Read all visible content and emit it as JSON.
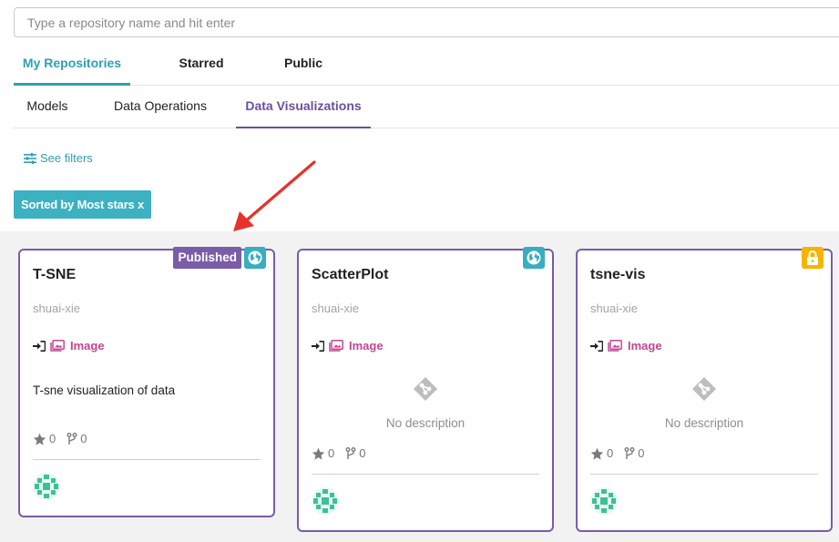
{
  "search": {
    "placeholder": "Type a repository name and hit enter"
  },
  "main_tabs": [
    {
      "label": "My Repositories",
      "active": true
    },
    {
      "label": "Starred",
      "active": false
    },
    {
      "label": "Public",
      "active": false
    }
  ],
  "sub_tabs": [
    {
      "label": "Models",
      "active": false
    },
    {
      "label": "Data Operations",
      "active": false
    },
    {
      "label": "Data Visualizations",
      "active": true
    }
  ],
  "filters": {
    "label": "See filters"
  },
  "sort": {
    "label": "Sorted by Most stars x"
  },
  "cards": [
    {
      "title": "T-SNE",
      "owner": "shuai-xie",
      "type_label": "Image",
      "description": "T-sne visualization of data",
      "stars": "0",
      "forks": "0",
      "visibility": "public",
      "badge": "Published"
    },
    {
      "title": "ScatterPlot",
      "owner": "shuai-xie",
      "type_label": "Image",
      "description": "No description",
      "stars": "0",
      "forks": "0",
      "visibility": "public"
    },
    {
      "title": "tsne-vis",
      "owner": "shuai-xie",
      "type_label": "Image",
      "description": "No description",
      "stars": "0",
      "forks": "0",
      "visibility": "private"
    }
  ],
  "colors": {
    "primary": "#2f9fb3",
    "accent_purple": "#7a5ca8",
    "type_pink": "#c24792",
    "lock_yellow": "#f5b400",
    "arrow_red": "#e8312a"
  }
}
